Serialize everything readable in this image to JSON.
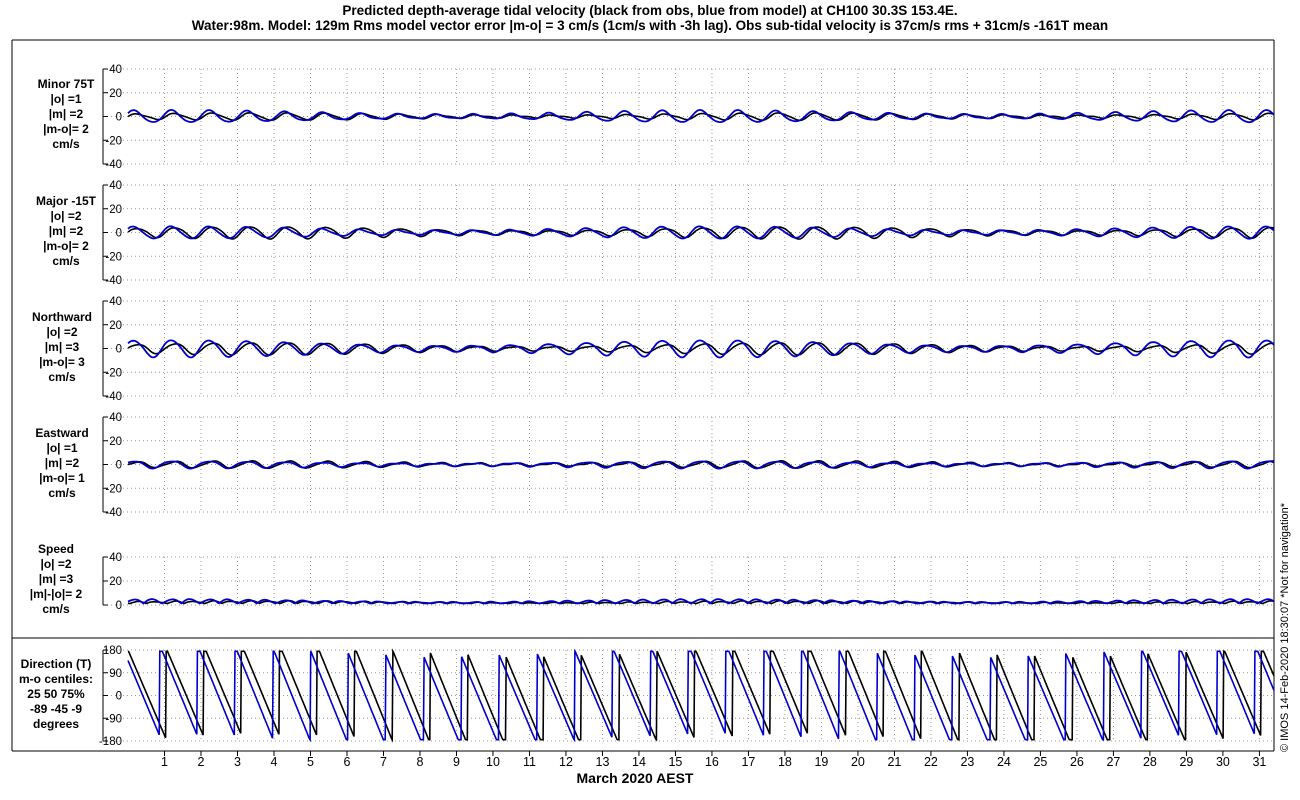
{
  "title": {
    "line1": "Predicted depth-average tidal velocity (black from obs, blue from model) at CH100 30.3S 153.4E.",
    "line2": "Water:98m. Model: 129m  Rms model vector error |m-o| = 3 cm/s (1cm/s with -3h lag). Obs sub-tidal velocity is 37cm/s rms + 31cm/s -161T mean"
  },
  "side_note": "© IMOS 14-Feb-2020 18:30:07  *Not for navigation*",
  "colors": {
    "obs": "#000000",
    "model": "#0000cc",
    "grid": "#999999"
  },
  "chart_data": [
    {
      "type": "line",
      "panel": "minor",
      "label_lines": [
        "Minor 75T",
        "|o| =1",
        "|m| =2",
        "|m-o|= 2",
        "cm/s"
      ],
      "ylim": [
        -40,
        40
      ],
      "yticks": [
        40,
        20,
        0,
        -20,
        -40
      ],
      "amp_obs": 1,
      "amp_model": 2,
      "series": [
        {
          "name": "obs",
          "color": "#000000"
        },
        {
          "name": "model",
          "color": "#0000cc"
        }
      ]
    },
    {
      "type": "line",
      "panel": "major",
      "label_lines": [
        "Major -15T",
        "|o| =2",
        "|m| =2",
        "|m-o|= 2",
        "cm/s"
      ],
      "ylim": [
        -40,
        40
      ],
      "yticks": [
        40,
        20,
        0,
        -20,
        -40
      ],
      "amp_obs": 2,
      "amp_model": 2,
      "series": [
        {
          "name": "obs",
          "color": "#000000"
        },
        {
          "name": "model",
          "color": "#0000cc"
        }
      ]
    },
    {
      "type": "line",
      "panel": "northward",
      "label_lines": [
        "Northward",
        "|o| =2",
        "|m| =3",
        "|m-o|= 3",
        "cm/s"
      ],
      "ylim": [
        -40,
        40
      ],
      "yticks": [
        40,
        20,
        0,
        -20,
        -40
      ],
      "amp_obs": 2,
      "amp_model": 3,
      "series": [
        {
          "name": "obs",
          "color": "#000000"
        },
        {
          "name": "model",
          "color": "#0000cc"
        }
      ]
    },
    {
      "type": "line",
      "panel": "eastward",
      "label_lines": [
        "Eastward",
        "|o| =1",
        "|m| =2",
        "|m-o|= 1",
        "cm/s"
      ],
      "ylim": [
        -40,
        40
      ],
      "yticks": [
        40,
        20,
        0,
        -20,
        -40
      ],
      "amp_obs": 1,
      "amp_model": 1,
      "series": [
        {
          "name": "obs",
          "color": "#000000"
        },
        {
          "name": "model",
          "color": "#0000cc"
        }
      ]
    },
    {
      "type": "line",
      "panel": "speed",
      "label_lines": [
        "Speed",
        "|o| =2",
        "|m| =3",
        "|m|-|o|= 2",
        "cm/s"
      ],
      "ylim": [
        0,
        40
      ],
      "yticks": [
        40,
        20,
        0
      ],
      "amp_obs": 1,
      "amp_model": 2,
      "series": [
        {
          "name": "obs",
          "color": "#000000"
        },
        {
          "name": "model",
          "color": "#0000cc"
        }
      ]
    },
    {
      "type": "line",
      "panel": "direction",
      "label_lines": [
        "Direction (T)",
        "m-o centiles:",
        "25  50  75%",
        "-89 -45  -9",
        "degrees"
      ],
      "ylim": [
        -180,
        180
      ],
      "yticks": [
        180,
        90,
        0,
        -90,
        -180
      ],
      "series": [
        {
          "name": "obs",
          "color": "#000000"
        },
        {
          "name": "model",
          "color": "#0000cc"
        }
      ]
    }
  ],
  "x_axis": {
    "label": "March 2020 AEST",
    "range_days": [
      0,
      31.4
    ],
    "ticks": [
      "1",
      "2",
      "3",
      "4",
      "5",
      "6",
      "7",
      "8",
      "9",
      "10",
      "11",
      "12",
      "13",
      "14",
      "15",
      "16",
      "17",
      "18",
      "19",
      "20",
      "21",
      "22",
      "23",
      "24",
      "25",
      "26",
      "27",
      "28",
      "29",
      "30",
      "31"
    ]
  }
}
